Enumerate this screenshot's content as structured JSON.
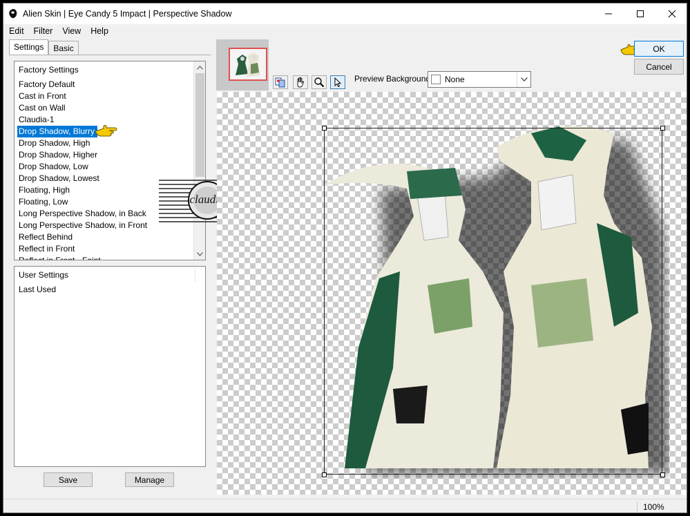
{
  "window": {
    "title": "Alien Skin | Eye Candy 5 Impact | Perspective Shadow",
    "minimize_icon": "minimize-icon",
    "maximize_icon": "maximize-icon",
    "close_icon": "close-icon"
  },
  "menu": {
    "items": [
      "Edit",
      "Filter",
      "View",
      "Help"
    ]
  },
  "tabs": {
    "settings": "Settings",
    "basic": "Basic"
  },
  "factory": {
    "header": "Factory Settings",
    "items": [
      "Factory Default",
      "Cast in Front",
      "Cast on Wall",
      "Claudia-1",
      "Drop Shadow, Blurry",
      "Drop Shadow, High",
      "Drop Shadow, Higher",
      "Drop Shadow, Low",
      "Drop Shadow, Lowest",
      "Floating, High",
      "Floating, Low",
      "Long Perspective Shadow, in Back",
      "Long Perspective Shadow, in Front",
      "Reflect Behind",
      "Reflect in Front",
      "Reflect in Front - Faint"
    ],
    "selected_index": 4
  },
  "user": {
    "header": "User Settings",
    "items": [
      "Last Used"
    ]
  },
  "buttons": {
    "save": "Save",
    "manage": "Manage",
    "ok": "OK",
    "cancel": "Cancel"
  },
  "preview": {
    "background_label": "Preview Background:",
    "background_value": "None",
    "tools": [
      "preview-compare-icon",
      "hand-pan-icon",
      "zoom-magnifier-icon",
      "arrow-select-icon"
    ]
  },
  "watermark": {
    "text": "claudia"
  },
  "status": {
    "zoom": "100%"
  },
  "colors": {
    "selection": "#0078d7",
    "ok_border": "#0078d7",
    "checker_dark": "#cccccc",
    "pointer_hand": "#f5c800"
  }
}
